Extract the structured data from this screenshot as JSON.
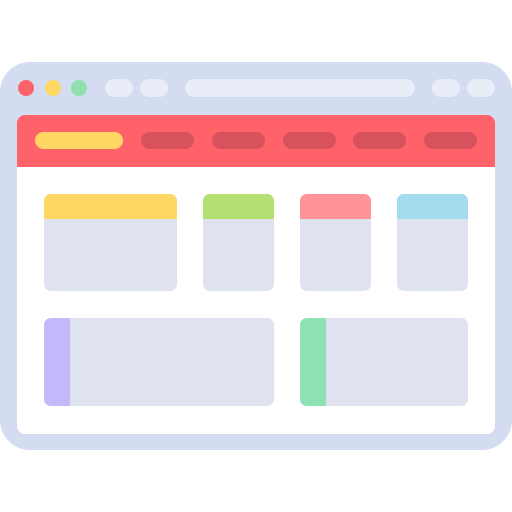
{
  "colors": {
    "frame": "#d3dcf0",
    "titlebar_pill": "#e8edf8",
    "content_bg": "#ffffff",
    "navbar": "#ff6369",
    "nav_item_active": "#ffd764",
    "nav_item": "#d7525d",
    "card_body": "#dfe3ef",
    "window_dot_close": "#ff6369",
    "window_dot_minimize": "#ffd764",
    "window_dot_maximize": "#8ee0ad"
  },
  "window_dots": [
    {
      "name": "close",
      "color": "#ff6369"
    },
    {
      "name": "minimize",
      "color": "#ffd764"
    },
    {
      "name": "maximize",
      "color": "#8ee0ad"
    }
  ],
  "nav_items": [
    {
      "active": true
    },
    {
      "active": false
    },
    {
      "active": false
    },
    {
      "active": false
    },
    {
      "active": false
    },
    {
      "active": false
    }
  ],
  "cards_top": [
    {
      "header_color": "#ffd764"
    },
    {
      "header_color": "#b3e070"
    },
    {
      "header_color": "#ff939a"
    },
    {
      "header_color": "#a4dcef"
    }
  ],
  "cards_bottom": [
    {
      "accent_color": "#c4b8fb"
    },
    {
      "accent_color": "#8ee0b5"
    }
  ]
}
